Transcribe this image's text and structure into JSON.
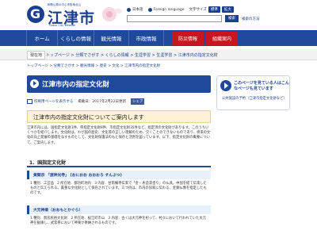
{
  "header": {
    "logo_sub": "和歌山県の中心市街地北山",
    "logo_title": "江津市",
    "logo_en": "Gotsu City Website",
    "util": {
      "language": "日本語",
      "foreign_language": "Foreign language",
      "text_size_label": "文字サイズ",
      "text_size_default": "標準",
      "text_size_large": "拡大"
    },
    "search": {
      "placeholder": "",
      "button": "検索",
      "links": "検索の方法"
    }
  },
  "nav": {
    "items": [
      "ホーム",
      "くらしの情報",
      "観光情報",
      "市政情報"
    ],
    "red_buttons": [
      "防災情報",
      "組織案内"
    ]
  },
  "location": {
    "label": "現在地",
    "path": "トップページ > 分類でさがす > くらしの情報 > 生涯学習 > 生涯学習 > 江津市内の指定文化財"
  },
  "breadcrumb": "トップページ > 分類でさがす > 観光情報 > 歴史 > 文化 > 江津市内の指定文化財",
  "page": {
    "title": "江津市内の指定文化財",
    "print_label": "印刷用ページを表示する",
    "updated": "掲載日：2017年2月22日更新",
    "share_label": "シェア"
  },
  "info_box": "江津市内の指定文化財についてご案内します",
  "intro": "江津市内には、国指定文化財3件、県指定文化財8件、市指定文化財35件など、指定済の文化財があります。このうちいくつかを紹介します。文化財は、わが国の歴史、文化等の正しい理解のため、欠くことのできないものであり、将来の文化の向上発展の基礎をなすものとして、文化財保護法のもと保存と活用を図っています。以下、指定文化財の概要について、ご案内します。",
  "section_title": "1．国指定文化財",
  "items": [
    {
      "heading": "黄檗宗 「渡神光寺」 (おにおお おおおろ すんぶつ)",
      "body": "1 種別．工芸品　2 所在地．都治町地内　3 内容．甘南備寺伝来で「金・木造漆塗り」の仏具。中国を経て伝来したものと伝えられる。貴重な文化財として保存されています。三つ目は、市内の旧家に伝わる、金銅仏像を指定したものです。"
    },
    {
      "heading": "大元神楽（おおもとかぐら）",
      "body": "1 種別．無形民俗文化財　2 所在地．桜江町市山　3 内容．古くは大元神を祀って、村々において行われていた大元神を勧請し、式年祭において神楽が奉納されるものです。"
    }
  ],
  "aside": {
    "title": "このページを見ている人はこんなページも見ています",
    "link": "公共施設の予約（江津市指定文化財など）"
  }
}
